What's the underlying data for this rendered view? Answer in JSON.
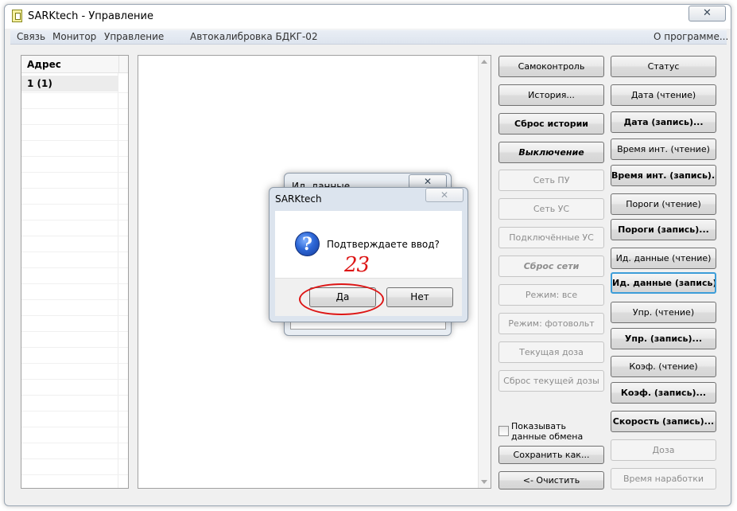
{
  "window": {
    "title": "SARKtech - Управление",
    "close_label": "✕"
  },
  "menu": [
    {
      "label": "Связь"
    },
    {
      "label": "Монитор"
    },
    {
      "label": "Управление"
    },
    {
      "label": "Автокалибровка БДКГ-02"
    },
    {
      "label": "О программе..."
    }
  ],
  "address_table": {
    "header": "Адрес",
    "rows": [
      "1 (1)"
    ]
  },
  "buttons_col1": [
    {
      "label": "Самоконтроль",
      "state": "normal"
    },
    {
      "label": "История...",
      "state": "normal"
    },
    {
      "label": "Сброс истории",
      "state": "bold"
    },
    {
      "label": "Выключение",
      "state": "bolditalic"
    },
    {
      "label": "Сеть ПУ",
      "state": "disabled"
    },
    {
      "label": "Сеть УС",
      "state": "disabled"
    },
    {
      "label": "Подключённые УС",
      "state": "disabled"
    },
    {
      "label": "Сброс сети",
      "state": "disabled-bolditalic"
    },
    {
      "label": "Режим: все",
      "state": "disabled"
    },
    {
      "label": "Режим: фотовольт",
      "state": "disabled"
    },
    {
      "label": "Текущая доза",
      "state": "disabled"
    },
    {
      "label": "Сброс текущей дозы",
      "state": "disabled"
    }
  ],
  "buttons_col2": [
    {
      "label": "Статус",
      "state": "normal"
    },
    {
      "label": "Дата (чтение)",
      "state": "normal"
    },
    {
      "label": "Дата (запись)...",
      "state": "bold"
    },
    {
      "label": "Время инт. (чтение)",
      "state": "normal"
    },
    {
      "label": "Время инт. (запись)...",
      "state": "bold"
    },
    {
      "label": "Пороги (чтение)",
      "state": "normal"
    },
    {
      "label": "Пороги (запись)...",
      "state": "bold"
    },
    {
      "label": "Ид. данные (чтение)",
      "state": "normal"
    },
    {
      "label": "Ид. данные (запись)...",
      "state": "bold-focused"
    },
    {
      "label": "Упр. (чтение)",
      "state": "normal"
    },
    {
      "label": "Упр. (запись)...",
      "state": "bold"
    },
    {
      "label": "Коэф. (чтение)",
      "state": "normal"
    },
    {
      "label": "Коэф. (запись)...",
      "state": "bold"
    },
    {
      "label": "Скорость (запись)...",
      "state": "bold"
    },
    {
      "label": "Доза",
      "state": "disabled"
    },
    {
      "label": "Время наработки",
      "state": "disabled"
    }
  ],
  "bottom_controls": {
    "checkbox_label": "Показывать данные обмена",
    "checkbox_checked": false,
    "save_label": "Сохранить как...",
    "clear_label": "<- Очистить"
  },
  "back_dialog": {
    "title": "Ид. данные",
    "close_label": "✕"
  },
  "confirm_dialog": {
    "title": "SARKtech",
    "close_label": "✕",
    "icon": "question-icon",
    "message": "Подтверждаете ввод?",
    "yes_label": "Да",
    "no_label": "Нет"
  },
  "annotation": {
    "text": "23",
    "color": "#dd1515"
  }
}
